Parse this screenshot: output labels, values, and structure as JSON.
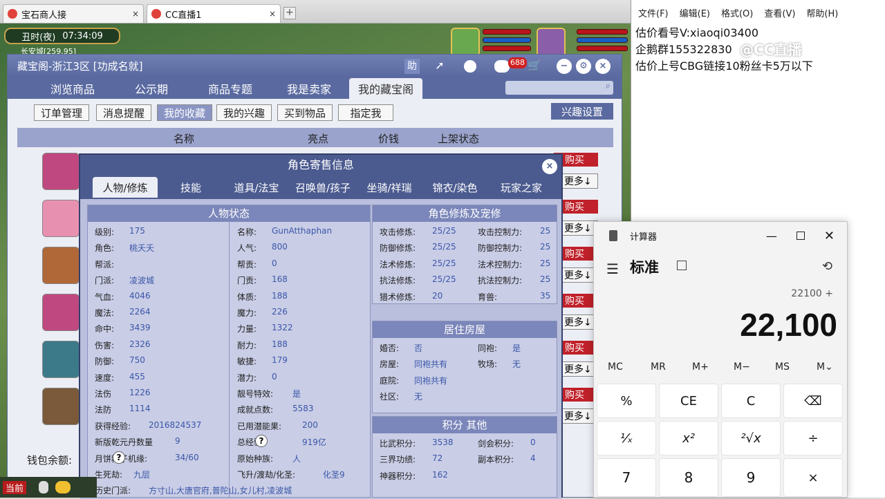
{
  "browser": {
    "tabs": [
      {
        "label": "宝石商人接",
        "close": "×"
      },
      {
        "label": "CC直播1",
        "close": "×"
      }
    ],
    "new_tab": "+"
  },
  "game": {
    "time": "丑时(夜)",
    "clock": "07:34:09",
    "location": "长安城[259,95]",
    "bottom": {
      "current": "当前"
    }
  },
  "window": {
    "title": "藏宝阁-浙江3区 [功成名就]",
    "help": "助",
    "badge": "688",
    "tabs": [
      "浏览商品",
      "公示期",
      "商品专题",
      "我是卖家",
      "我的藏宝阁"
    ],
    "active_tab": 4,
    "subbuttons": [
      "订单管理",
      "消息提醒",
      "我的收藏",
      "我的兴趣",
      "买到物品",
      "指定我"
    ],
    "active_sub": 2,
    "interest_setting": "兴趣设置",
    "columns": [
      "名称",
      "亮点",
      "价钱",
      "上架状态"
    ],
    "buy_label": "购买",
    "more_label": "更多↓",
    "wallet": "钱包余额:"
  },
  "popup": {
    "title": "角色寄售信息",
    "tabs": [
      "人物/修炼",
      "技能",
      "道具/法宝",
      "召唤兽/孩子",
      "坐骑/祥瑞",
      "锦衣/染色",
      "玩家之家"
    ],
    "active_tab": 0,
    "status_title": "人物状态",
    "left_col": [
      {
        "k": "级别:",
        "v": "175"
      },
      {
        "k": "角色:",
        "v": "桃夭夭"
      },
      {
        "k": "帮派:",
        "v": ""
      },
      {
        "k": "门派:",
        "v": "凌波城"
      },
      {
        "k": "气血:",
        "v": "4046"
      },
      {
        "k": "魔法:",
        "v": "2264"
      },
      {
        "k": "命中:",
        "v": "3439"
      },
      {
        "k": "伤害:",
        "v": "2326"
      },
      {
        "k": "防御:",
        "v": "750"
      },
      {
        "k": "速度:",
        "v": "455"
      },
      {
        "k": "法伤",
        "v": "1226"
      },
      {
        "k": "法防",
        "v": "1114"
      },
      {
        "k": "获得经验:",
        "v": "2016824537"
      },
      {
        "k": "新版乾元丹数量",
        "v": "9"
      },
      {
        "k": "月饼粽子机缘:",
        "v": "34/60"
      },
      {
        "k": "生死劫:",
        "v": "九层"
      },
      {
        "k": "历史门派:",
        "v": "方寸山,大唐官府,普陀山,女儿村,凌波城"
      }
    ],
    "right_col": [
      {
        "k": "名称:",
        "v": "GunAtthaphan"
      },
      {
        "k": "人气:",
        "v": "800"
      },
      {
        "k": "帮贡:",
        "v": "0"
      },
      {
        "k": "门贡:",
        "v": "168"
      },
      {
        "k": "体质:",
        "v": "188"
      },
      {
        "k": "魔力:",
        "v": "226"
      },
      {
        "k": "力量:",
        "v": "1322"
      },
      {
        "k": "耐力:",
        "v": "188"
      },
      {
        "k": "敏捷:",
        "v": "179"
      },
      {
        "k": "潜力:",
        "v": "0"
      },
      {
        "k": "靓号特效:",
        "v": "是"
      },
      {
        "k": "成就点数:",
        "v": "5583"
      },
      {
        "k": "已用潜能果:",
        "v": "200"
      },
      {
        "k": "总经验:",
        "v": "919亿"
      },
      {
        "k": "原始种族:",
        "v": "人"
      },
      {
        "k": "飞升/渡劫/化圣:",
        "v": "化圣9"
      }
    ],
    "cultivation_title": "角色修炼及宠修",
    "cultivation": [
      {
        "k": "攻击修炼:",
        "v": "25/25",
        "k2": "攻击控制力:",
        "v2": "25"
      },
      {
        "k": "防御修炼:",
        "v": "25/25",
        "k2": "防御控制力:",
        "v2": "25"
      },
      {
        "k": "法术修炼:",
        "v": "25/25",
        "k2": "法术控制力:",
        "v2": "25"
      },
      {
        "k": "抗法修炼:",
        "v": "25/25",
        "k2": "抗法控制力:",
        "v2": "25"
      },
      {
        "k": "猎术修炼:",
        "v": "20",
        "k2": "育兽:",
        "v2": "35"
      }
    ],
    "house_title": "居住房屋",
    "house": [
      {
        "k": "婚否:",
        "v": "否",
        "k2": "同袍:",
        "v2": "是"
      },
      {
        "k": "房屋:",
        "v": "同袍共有",
        "k2": "牧场:",
        "v2": "无"
      },
      {
        "k": "庭院:",
        "v": "同袍共有",
        "k2": "",
        "v2": ""
      },
      {
        "k": "社区:",
        "v": "无",
        "k2": "",
        "v2": ""
      }
    ],
    "score_title": "积分 其他",
    "score": [
      {
        "k": "比武积分:",
        "v": "3538",
        "k2": "剑会积分:",
        "v2": "0"
      },
      {
        "k": "三界功绩:",
        "v": "72",
        "k2": "副本积分:",
        "v2": "4"
      },
      {
        "k": "神器积分:",
        "v": "162",
        "k2": "",
        "v2": ""
      }
    ]
  },
  "notepad": {
    "menu": [
      "文件(F)",
      "编辑(E)",
      "格式(O)",
      "查看(V)",
      "帮助(H)"
    ],
    "lines": [
      "估价看号V:xiaoqi03400",
      "企鹅群155322830",
      "估价上号CBG链接10粉丝卡5万以下"
    ],
    "overlay": "@CC直播"
  },
  "calculator": {
    "title": "计算器",
    "mode": "标准",
    "expression": "22100 +",
    "display": "22,100",
    "memory": [
      "MC",
      "MR",
      "M+",
      "M−",
      "MS",
      "M⌄"
    ],
    "keys": [
      "%",
      "CE",
      "C",
      "⌫",
      "¹⁄ₓ",
      "x²",
      "²√x",
      "÷",
      "7",
      "8",
      "9",
      "×"
    ]
  }
}
